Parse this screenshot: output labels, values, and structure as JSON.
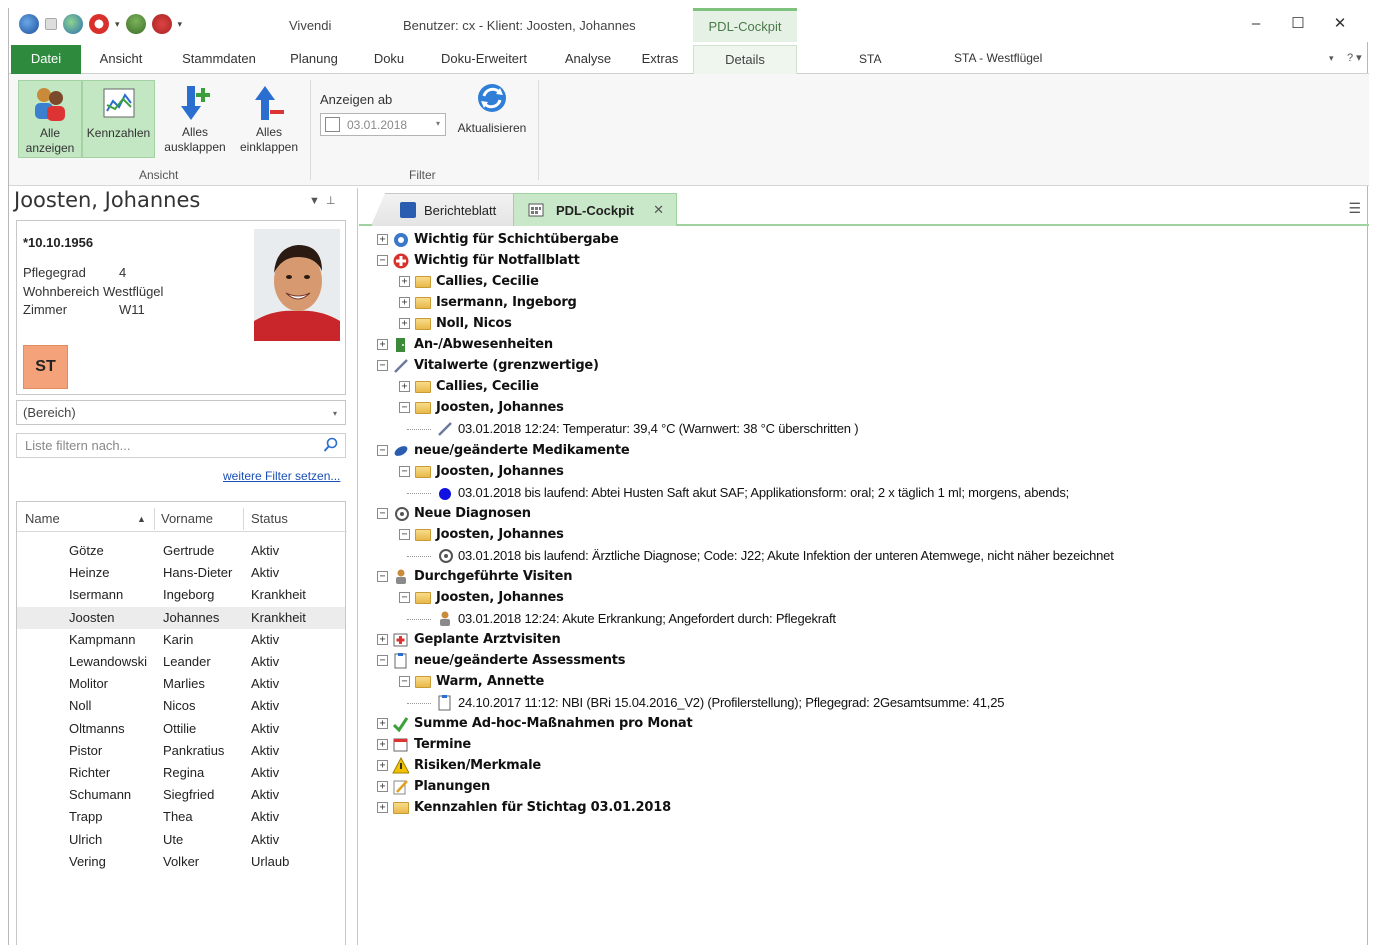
{
  "titlebar": {
    "app": "Vivendi",
    "user": "Benutzer: cx - Klient: Joosten, Johannes",
    "context_tab": "PDL-Cockpit",
    "minimize": "–",
    "maximize": "☐",
    "close": "✕"
  },
  "ribbon_tabs": [
    "Datei",
    "Ansicht",
    "Stammdaten",
    "Planung",
    "Doku",
    "Doku-Erweitert",
    "Analyse",
    "Extras",
    "Details"
  ],
  "station": {
    "code": "STA",
    "name": "STA - Westflügel",
    "help": "? ▾"
  },
  "ribbon": {
    "btn_all_show": "Alle anzeigen",
    "btn_kennzahlen": "Kennzahlen",
    "btn_expand": "Alles ausklappen",
    "btn_collapse": "Alles einklappen",
    "group_ansicht": "Ansicht",
    "filter_title": "Anzeigen ab",
    "filter_date": "03.01.2018",
    "btn_refresh": "Aktualisieren",
    "group_filter": "Filter"
  },
  "patient": {
    "name": "Joosten, Johannes",
    "dob": "*10.10.1956",
    "pflegegrad_label": "Pflegegrad",
    "pflegegrad": "4",
    "wohnbereich": "Wohnbereich Westflügel",
    "zimmer_label": "Zimmer",
    "zimmer": "W11",
    "badge": "ST"
  },
  "left": {
    "bereich": "(Bereich)",
    "filter_placeholder": "Liste filtern nach...",
    "more_filter": "weitere Filter setzen...",
    "col_name": "Name",
    "col_vorname": "Vorname",
    "col_status": "Status",
    "rows": [
      {
        "name": "Götze",
        "vorname": "Gertrude",
        "status": "Aktiv"
      },
      {
        "name": "Heinze",
        "vorname": "Hans-Dieter",
        "status": "Aktiv"
      },
      {
        "name": "Isermann",
        "vorname": "Ingeborg",
        "status": "Krankheit"
      },
      {
        "name": "Joosten",
        "vorname": "Johannes",
        "status": "Krankheit"
      },
      {
        "name": "Kampmann",
        "vorname": "Karin",
        "status": "Aktiv"
      },
      {
        "name": "Lewandowski",
        "vorname": "Leander",
        "status": "Aktiv"
      },
      {
        "name": "Molitor",
        "vorname": "Marlies",
        "status": "Aktiv"
      },
      {
        "name": "Noll",
        "vorname": "Nicos",
        "status": "Aktiv"
      },
      {
        "name": "Oltmanns",
        "vorname": "Ottilie",
        "status": "Aktiv"
      },
      {
        "name": "Pistor",
        "vorname": "Pankratius",
        "status": "Aktiv"
      },
      {
        "name": "Richter",
        "vorname": "Regina",
        "status": "Aktiv"
      },
      {
        "name": "Schumann",
        "vorname": "Siegfried",
        "status": "Aktiv"
      },
      {
        "name": "Trapp",
        "vorname": "Thea",
        "status": "Aktiv"
      },
      {
        "name": "Ulrich",
        "vorname": "Ute",
        "status": "Aktiv"
      },
      {
        "name": "Vering",
        "vorname": "Volker",
        "status": "Urlaub"
      }
    ]
  },
  "doc_tabs": {
    "berichteblatt": "Berichteblatt",
    "cockpit": "PDL-Cockpit",
    "close": "✕"
  },
  "tree": [
    {
      "label": "Wichtig für Schichtübergabe",
      "level": 0,
      "exp": "+",
      "icon": "handover-icon"
    },
    {
      "label": "Wichtig für Notfallblatt",
      "level": 0,
      "exp": "−",
      "icon": "emergency-icon"
    },
    {
      "label": "Callies, Cecilie",
      "level": 1,
      "exp": "+",
      "icon": "folder-icon"
    },
    {
      "label": "Isermann, Ingeborg",
      "level": 1,
      "exp": "+",
      "icon": "folder-icon"
    },
    {
      "label": "Noll, Nicos",
      "level": 1,
      "exp": "+",
      "icon": "folder-icon"
    },
    {
      "label": "An-/Abwesenheiten",
      "level": 0,
      "exp": "+",
      "icon": "door-icon"
    },
    {
      "label": "Vitalwerte (grenzwertige)",
      "level": 0,
      "exp": "−",
      "icon": "thermometer-icon"
    },
    {
      "label": "Callies, Cecilie",
      "level": 1,
      "exp": "+",
      "icon": "folder-icon"
    },
    {
      "label": "Joosten, Johannes",
      "level": 1,
      "exp": "−",
      "icon": "folder-icon"
    },
    {
      "label": "03.01.2018 12:24: Temperatur: 39,4 °C (Warnwert: 38 °C überschritten )",
      "level": 2,
      "exp": "",
      "icon": "thermometer-icon",
      "leaf": true
    },
    {
      "label": "neue/geänderte Medikamente",
      "level": 0,
      "exp": "−",
      "icon": "pill-icon"
    },
    {
      "label": "Joosten, Johannes",
      "level": 1,
      "exp": "−",
      "icon": "folder-icon"
    },
    {
      "label": "03.01.2018 bis laufend: Abtei Husten Saft akut SAF; Applikationsform: oral; 2 x täglich 1 ml; morgens, abends;",
      "level": 2,
      "exp": "",
      "icon": "dot-icon",
      "leaf": true
    },
    {
      "label": "Neue Diagnosen",
      "level": 0,
      "exp": "−",
      "icon": "diagnosis-icon"
    },
    {
      "label": "Joosten, Johannes",
      "level": 1,
      "exp": "−",
      "icon": "folder-icon"
    },
    {
      "label": "03.01.2018 bis laufend: Ärztliche Diagnose; Code: J22; Akute Infektion der unteren Atemwege, nicht näher bezeichnet",
      "level": 2,
      "exp": "",
      "icon": "diagnosis-icon",
      "leaf": true
    },
    {
      "label": "Durchgeführte Visiten",
      "level": 0,
      "exp": "−",
      "icon": "doctor-icon"
    },
    {
      "label": "Joosten, Johannes",
      "level": 1,
      "exp": "−",
      "icon": "folder-icon"
    },
    {
      "label": "03.01.2018 12:24: Akute Erkrankung; Angefordert durch: Pflegekraft",
      "level": 2,
      "exp": "",
      "icon": "doctor-icon",
      "leaf": true
    },
    {
      "label": "Geplante Arztvisiten",
      "level": 0,
      "exp": "+",
      "icon": "medkit-icon"
    },
    {
      "label": "neue/geänderte Assessments",
      "level": 0,
      "exp": "−",
      "icon": "clipboard-icon"
    },
    {
      "label": "Warm, Annette",
      "level": 1,
      "exp": "−",
      "icon": "folder-icon"
    },
    {
      "label": "24.10.2017 11:12: NBI (BRi 15.04.2016_V2) (Profilerstellung); Pflegegrad: 2Gesamtsumme: 41,25",
      "level": 2,
      "exp": "",
      "icon": "clipboard-icon",
      "leaf": true
    },
    {
      "label": "Summe Ad-hoc-Maßnahmen pro Monat",
      "level": 0,
      "exp": "+",
      "icon": "measures-icon"
    },
    {
      "label": "Termine",
      "level": 0,
      "exp": "+",
      "icon": "calendar-icon"
    },
    {
      "label": "Risiken/Merkmale",
      "level": 0,
      "exp": "+",
      "icon": "warning-icon"
    },
    {
      "label": "Planungen",
      "level": 0,
      "exp": "+",
      "icon": "pencil-note-icon"
    },
    {
      "label": "Kennzahlen für Stichtag 03.01.2018",
      "level": 0,
      "exp": "+",
      "icon": "folder-icon"
    }
  ],
  "colors": {
    "accent": "#2e8b3e",
    "tab_active": "#c9e8c9",
    "badge": "#f4a27a",
    "link": "#1a4fb5"
  }
}
